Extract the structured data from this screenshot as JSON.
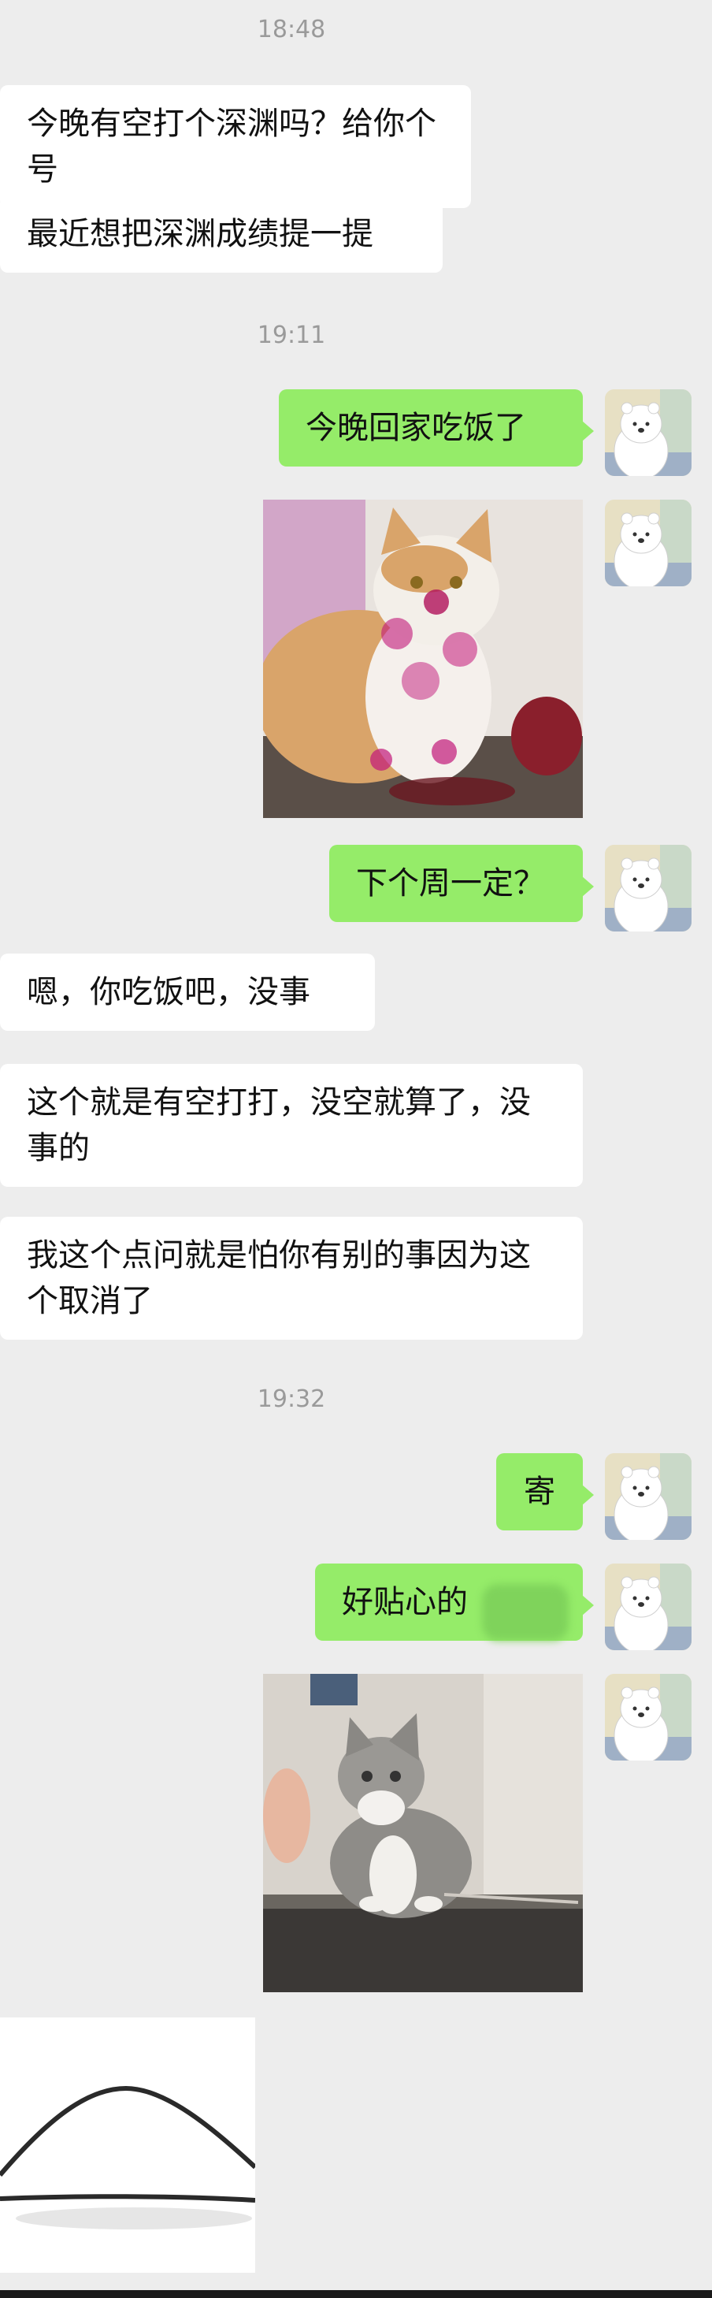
{
  "timestamps": [
    "18:48",
    "19:11",
    "19:32"
  ],
  "messages": {
    "m1": "今晚有空打个深渊吗？给你个号",
    "m2": "最近想把深渊成绩提一提",
    "m3": "今晚回家吃饭了",
    "m4": "下个周一定？",
    "m5": "嗯，你吃饭吧，没事",
    "m6": "这个就是有空打打，没空就算了，没事的",
    "m7": "我这个点问就是怕你有别的事因为这个取消了",
    "m8": "寄",
    "m9": "好贴心的"
  },
  "colors": {
    "background": "#ededed",
    "incoming_bubble": "#ffffff",
    "outgoing_bubble": "#95ec69",
    "timestamp": "#9a9a9a"
  },
  "icons": {
    "avatar": "white-bear-avatar-icon",
    "photo1": "cat-with-dragon-fruit-stain",
    "photo2": "cat-on-desk",
    "sticker": "curved-line-sticker"
  }
}
